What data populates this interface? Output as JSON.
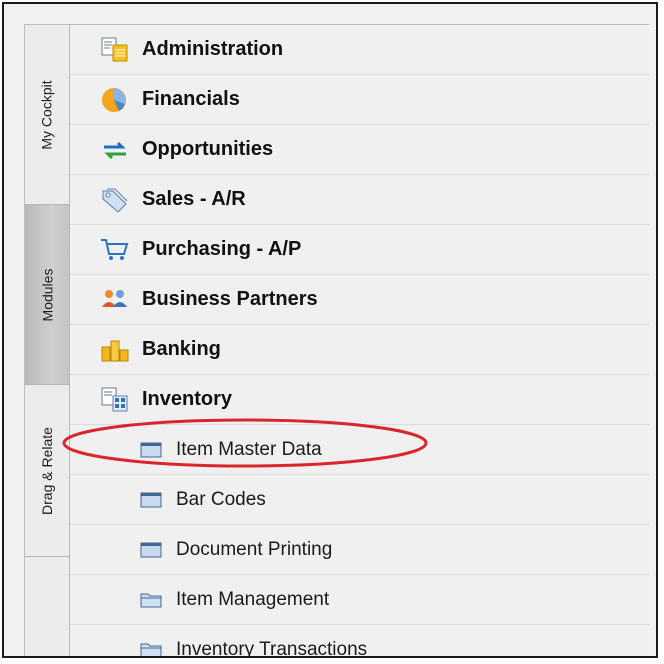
{
  "tabs": [
    {
      "label": "My Cockpit",
      "active": false
    },
    {
      "label": "Modules",
      "active": true
    },
    {
      "label": "Drag & Relate",
      "active": false
    }
  ],
  "modules": [
    {
      "label": "Administration",
      "icon": "administration-icon"
    },
    {
      "label": "Financials",
      "icon": "financials-pie-icon"
    },
    {
      "label": "Opportunities",
      "icon": "opportunities-arrows-icon"
    },
    {
      "label": "Sales - A/R",
      "icon": "sales-tags-icon"
    },
    {
      "label": "Purchasing - A/P",
      "icon": "shopping-cart-icon"
    },
    {
      "label": "Business Partners",
      "icon": "business-partners-icon"
    },
    {
      "label": "Banking",
      "icon": "banking-coins-icon"
    },
    {
      "label": "Inventory",
      "icon": "inventory-icon"
    }
  ],
  "inventory_items": [
    {
      "label": "Item Master Data",
      "icon": "window-icon",
      "highlighted": true
    },
    {
      "label": "Bar Codes",
      "icon": "window-icon"
    },
    {
      "label": "Document Printing",
      "icon": "window-icon"
    },
    {
      "label": "Item Management",
      "icon": "folder-icon"
    },
    {
      "label": "Inventory Transactions",
      "icon": "folder-icon"
    }
  ],
  "colors": {
    "highlight_ellipse": "#d9262b",
    "active_tab": "#c4c4c4"
  }
}
